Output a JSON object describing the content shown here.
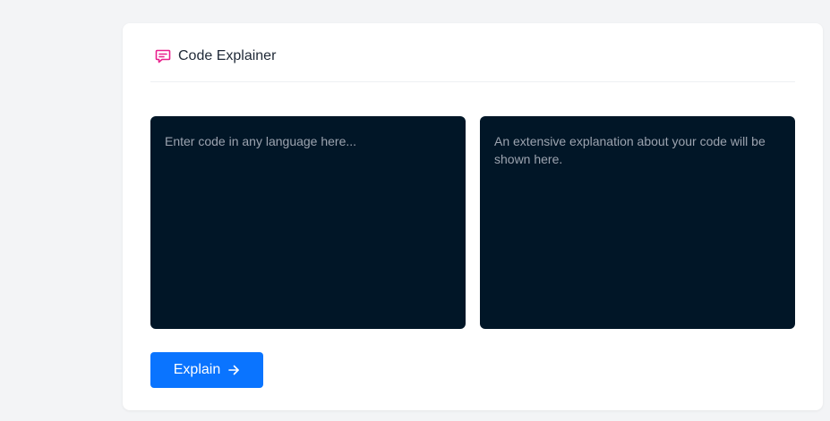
{
  "app": {
    "title": "Code Explainer",
    "icon": "chat-bubble-icon",
    "accent_color": "#e91e8c"
  },
  "input_panel": {
    "placeholder": "Enter code in any language here...",
    "value": "",
    "background": "#011627"
  },
  "output_panel": {
    "text": "An extensive explanation about your code will be shown here.",
    "background": "#011627"
  },
  "actions": {
    "explain_label": "Explain",
    "explain_icon": "arrow-right-icon",
    "button_color": "#0a74ff"
  }
}
